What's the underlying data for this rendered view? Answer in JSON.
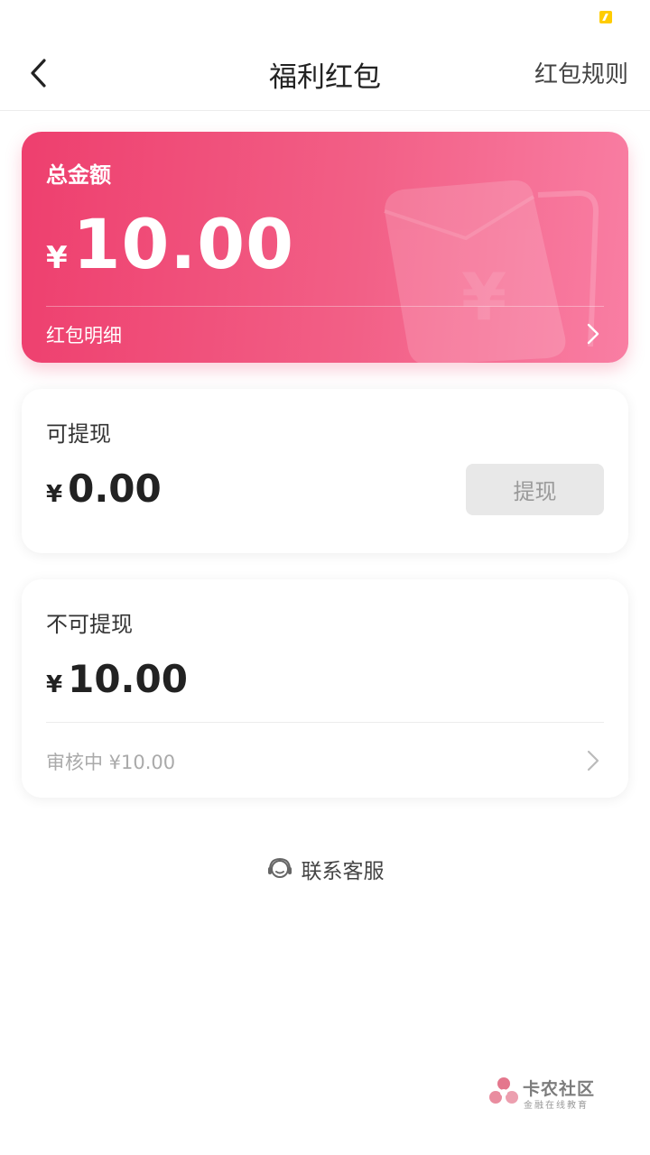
{
  "colors": {
    "brand_pink": "#ee3f6e",
    "status_icon": "#ffcc00",
    "disabled_button_bg": "#e8e8e8",
    "disabled_button_text": "#9a9a9a",
    "muted_text": "#aaaaaa"
  },
  "nav": {
    "back_icon": "chevron-left-icon",
    "title": "福利红包",
    "rules_link": "红包规则"
  },
  "total_card": {
    "label": "总金额",
    "currency": "¥",
    "amount": "10.00",
    "detail_link": "红包明细",
    "detail_icon": "chevron-right-icon",
    "decor_icon": "red-envelope-icon"
  },
  "withdrawable": {
    "label": "可提现",
    "currency": "¥",
    "amount": "0.00",
    "button_label": "提现",
    "button_disabled": true
  },
  "non_withdrawable": {
    "label": "不可提现",
    "currency": "¥",
    "amount": "10.00",
    "review_text": "审核中 ¥10.00",
    "review_icon": "chevron-right-icon"
  },
  "service": {
    "icon": "headset-icon",
    "label": "联系客服"
  },
  "watermark": {
    "title": "卡农社区",
    "subtitle": "金融在线教育"
  }
}
